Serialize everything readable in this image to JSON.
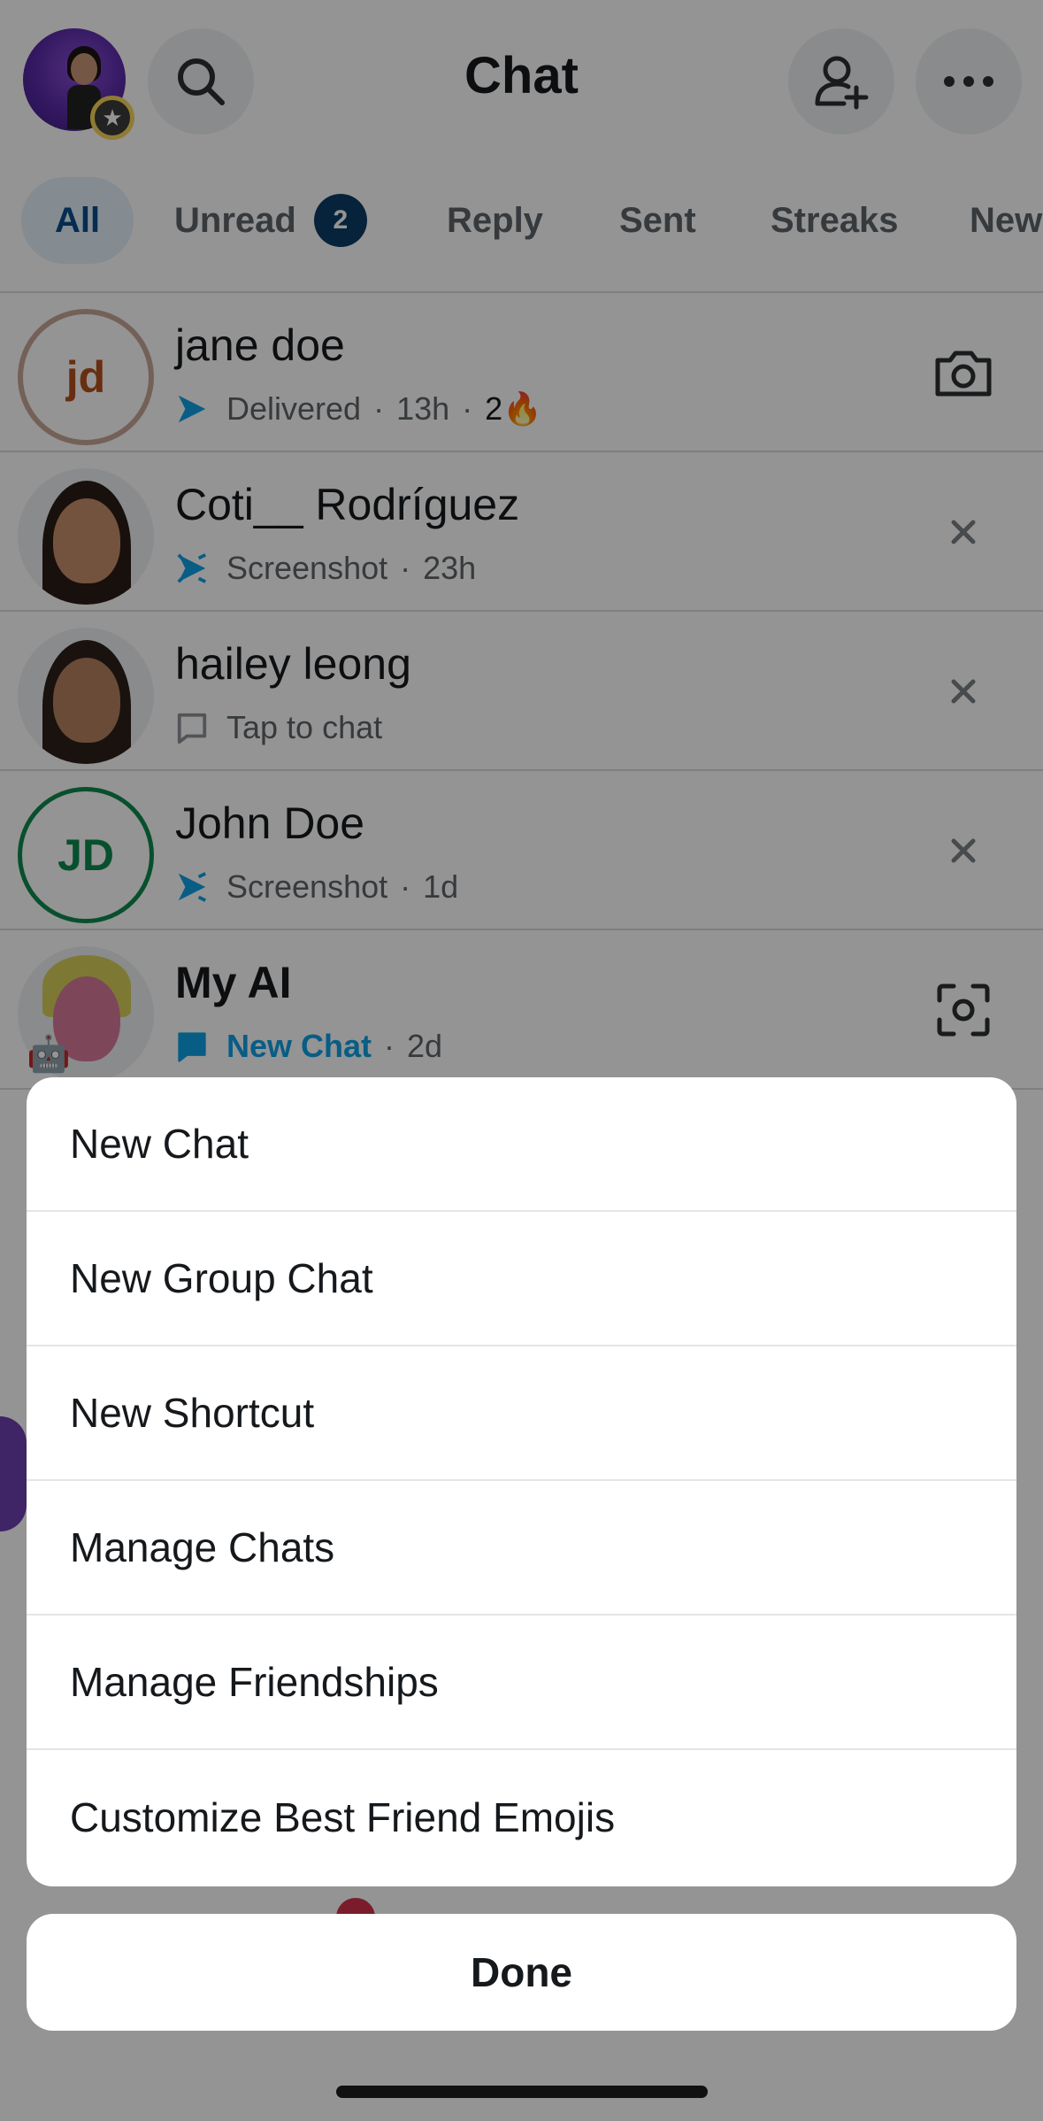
{
  "header": {
    "title": "Chat"
  },
  "tabs": [
    {
      "label": "All",
      "active": true
    },
    {
      "label": "Unread",
      "badge": "2"
    },
    {
      "label": "Reply"
    },
    {
      "label": "Sent"
    },
    {
      "label": "Streaks"
    },
    {
      "label": "New"
    }
  ],
  "chats": [
    {
      "name": "jane doe",
      "initials": "jd",
      "status": "Delivered",
      "time": "13h",
      "streak": "2🔥",
      "action": "camera-icon"
    },
    {
      "name": "Coti__ Rodríguez",
      "status": "Screenshot",
      "time": "23h",
      "action": "close-icon"
    },
    {
      "name": "hailey leong",
      "status": "Tap to chat",
      "action": "close-icon"
    },
    {
      "name": "John Doe",
      "initials": "JD",
      "status": "Screenshot",
      "time": "1d",
      "action": "close-icon"
    },
    {
      "name": "My AI",
      "status": "New Chat",
      "time": "2d",
      "action": "scan-icon"
    }
  ],
  "menu": {
    "items": [
      "New Chat",
      "New Group Chat",
      "New Shortcut",
      "Manage Chats",
      "Manage Friendships",
      "Customize Best Friend Emojis"
    ],
    "done_label": "Done"
  },
  "colors": {
    "accent_blue": "#0fa1e6",
    "jd_orange": "#b4501e",
    "jd_green": "#0f8a4f",
    "tab_active_bg": "#e4f0fa",
    "badge_navy": "#0b3d66"
  }
}
